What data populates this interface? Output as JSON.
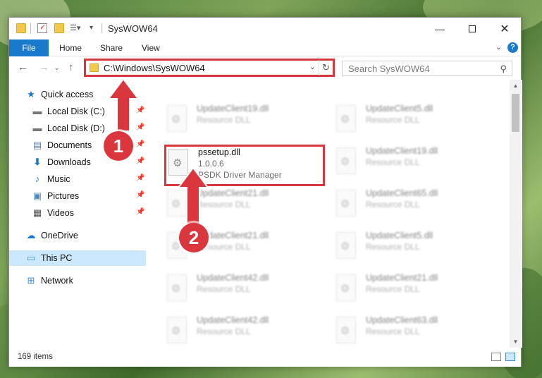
{
  "window": {
    "title": "SysWOW64"
  },
  "ribbon": {
    "tabs": [
      "File",
      "Home",
      "Share",
      "View"
    ],
    "help_label": "?"
  },
  "navigation": {
    "back_icon": "arrow-left-icon",
    "forward_icon": "arrow-right-icon",
    "up_icon": "arrow-up-icon",
    "address_path": "C:\\Windows\\SysWOW64",
    "search_placeholder": "Search SysWOW64"
  },
  "sidebar": {
    "items": [
      {
        "label": "Quick access",
        "icon": "star-icon",
        "pinned": false,
        "selected": false
      },
      {
        "label": "Local Disk (C:)",
        "icon": "drive-icon",
        "pinned": true,
        "selected": false
      },
      {
        "label": "Local Disk (D:)",
        "icon": "drive-icon",
        "pinned": true,
        "selected": false
      },
      {
        "label": "Documents",
        "icon": "documents-icon",
        "pinned": true,
        "selected": false
      },
      {
        "label": "Downloads",
        "icon": "download-icon",
        "pinned": true,
        "selected": false
      },
      {
        "label": "Music",
        "icon": "music-icon",
        "pinned": true,
        "selected": false
      },
      {
        "label": "Pictures",
        "icon": "pictures-icon",
        "pinned": true,
        "selected": false
      },
      {
        "label": "Videos",
        "icon": "videos-icon",
        "pinned": true,
        "selected": false
      },
      {
        "label": "OneDrive",
        "icon": "cloud-icon",
        "pinned": false,
        "selected": false
      },
      {
        "label": "This PC",
        "icon": "computer-icon",
        "pinned": false,
        "selected": true
      },
      {
        "label": "Network",
        "icon": "network-icon",
        "pinned": false,
        "selected": false
      }
    ]
  },
  "files": {
    "highlighted": {
      "name": "pssetup.dll",
      "version": "1.0.0.6",
      "description": "PSDK Driver Manager"
    },
    "left_column": [
      {
        "name": "UpdateClient19.dll",
        "type": "Resource DLL"
      },
      {
        "name": "UpdateClient21.dll",
        "type": "Resource DLL"
      },
      {
        "name": "UpdateClient21.dll",
        "type": "Resource DLL"
      },
      {
        "name": "UpdateClient42.dll",
        "type": "Resource DLL"
      },
      {
        "name": "UpdateClient42.dll",
        "type": "Resource DLL"
      }
    ],
    "right_column": [
      {
        "name": "UpdateClient5.dll",
        "type": "Resource DLL"
      },
      {
        "name": "UpdateClient19.dll",
        "type": "Resource DLL"
      },
      {
        "name": "UpdateClient65.dll",
        "type": "Resource DLL"
      },
      {
        "name": "UpdateClient5.dll",
        "type": "Resource DLL"
      },
      {
        "name": "UpdateClient21.dll",
        "type": "Resource DLL"
      },
      {
        "name": "UpdateClient63.dll",
        "type": "Resource DLL"
      }
    ]
  },
  "status": {
    "item_count": "169 items"
  },
  "callouts": {
    "step1": "1",
    "step2": "2"
  },
  "colors": {
    "accent": "#1979ca",
    "highlight_red": "#d9363e",
    "selection": "#cce8ff"
  }
}
